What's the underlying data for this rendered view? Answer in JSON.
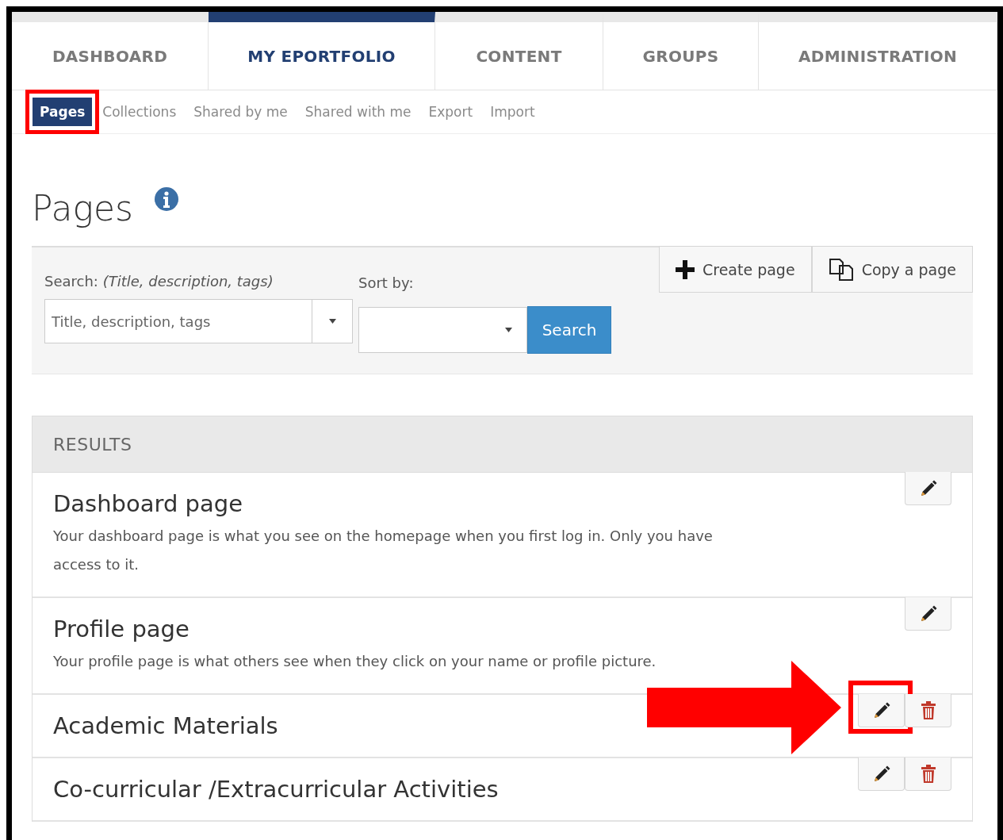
{
  "tabs": [
    {
      "label": "DASHBOARD",
      "selected": false
    },
    {
      "label": "MY EPORTFOLIO",
      "selected": true
    },
    {
      "label": "CONTENT",
      "selected": false
    },
    {
      "label": "GROUPS",
      "selected": false
    },
    {
      "label": "ADMINISTRATION",
      "selected": false
    }
  ],
  "subnav": [
    {
      "label": "Pages",
      "selected": true,
      "highlighted": true
    },
    {
      "label": "Collections",
      "selected": false,
      "highlighted": false
    },
    {
      "label": "Shared by me",
      "selected": false,
      "highlighted": false
    },
    {
      "label": "Shared with me",
      "selected": false,
      "highlighted": false
    },
    {
      "label": "Export",
      "selected": false,
      "highlighted": false
    },
    {
      "label": "Import",
      "selected": false,
      "highlighted": false
    }
  ],
  "page_title": "Pages",
  "search": {
    "label": "Search: *(Title, description, tags)*",
    "placeholder": "Title, description, tags",
    "sort_label": "Sort by:",
    "button": "Search"
  },
  "actions": [
    {
      "kind": "create",
      "label": "Create page"
    },
    {
      "kind": "copy",
      "label": "Copy a page"
    }
  ],
  "results": {
    "header": "RESULTS",
    "items": [
      {
        "title": "Dashboard page",
        "description": "Your dashboard page is what you see on the homepage when you first log in. Only you have access to it.",
        "buttons": [
          {
            "kind": "edit",
            "highlighted": false
          }
        ]
      },
      {
        "title": "Profile page",
        "description": "Your profile page is what others see when they click on your name or profile picture.",
        "buttons": [
          {
            "kind": "edit",
            "highlighted": false
          }
        ]
      },
      {
        "title": "Academic Materials",
        "buttons": [
          {
            "kind": "edit",
            "highlighted": true
          },
          {
            "kind": "delete",
            "highlighted": false
          }
        ]
      },
      {
        "title": "Co-curricular /Extracurricular Activities",
        "buttons": [
          {
            "kind": "edit",
            "highlighted": false
          },
          {
            "kind": "delete",
            "highlighted": false
          }
        ]
      }
    ]
  }
}
